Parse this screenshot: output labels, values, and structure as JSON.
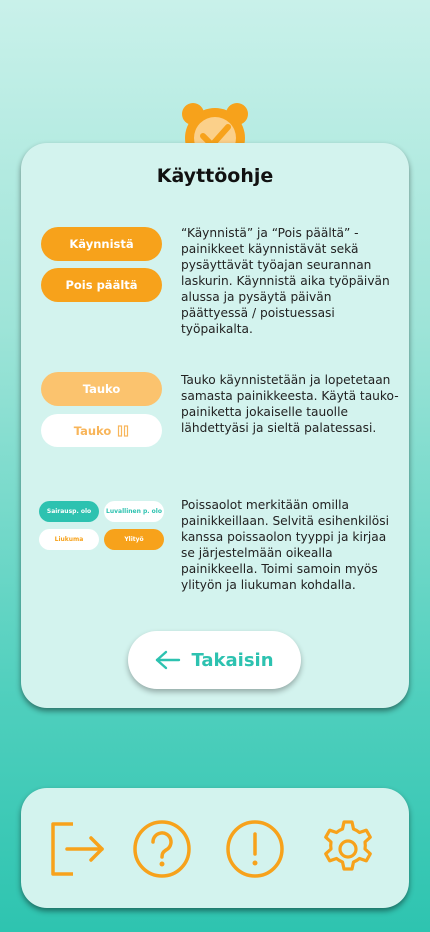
{
  "colors": {
    "accent_orange": "#f7a21b",
    "accent_teal": "#2dc2b0",
    "card_bg": "#d3f3ee"
  },
  "header": {
    "logo_icon": "alarm-clock-check-icon"
  },
  "guide": {
    "title": "Käyttöohje",
    "section1": {
      "start_label": "Käynnistä",
      "stop_label": "Pois päältä",
      "description": "“Käynnistä” ja “Pois päältä” -painikkeet käynnistävät sekä pysäyttävät työajan seurannan laskurin. Käynnistä aika työpäivän alussa ja pysäytä päivän päättyessä / poistuessasi työpaikalta."
    },
    "section2": {
      "pause_label": "Tauko",
      "pause_active_label": "Tauko",
      "description": "Tauko käynnistetään ja lopetetaan samasta painikkeesta. Käytä tauko-painiketta jokaiselle tauolle lähdettyäsi ja sieltä palatessasi."
    },
    "section3": {
      "sick_label": "Sairausp. olo",
      "permit_label": "Luvallinen p. olo",
      "flex_label": "Liukuma",
      "overtime_label": "Ylityö",
      "description": "Poissaolot merkitään omilla painikkeillaan. Selvitä esihenkilösi kanssa poissaolon tyyppi ja kirjaa se järjestelmään oikealla painikkeella. Toimi samoin myös ylityön ja liukuman kohdalla."
    },
    "back_label": "Takaisin"
  },
  "bottom_nav": {
    "items": [
      {
        "icon": "logout-icon"
      },
      {
        "icon": "help-icon"
      },
      {
        "icon": "alert-icon"
      },
      {
        "icon": "settings-gear-icon"
      }
    ]
  }
}
